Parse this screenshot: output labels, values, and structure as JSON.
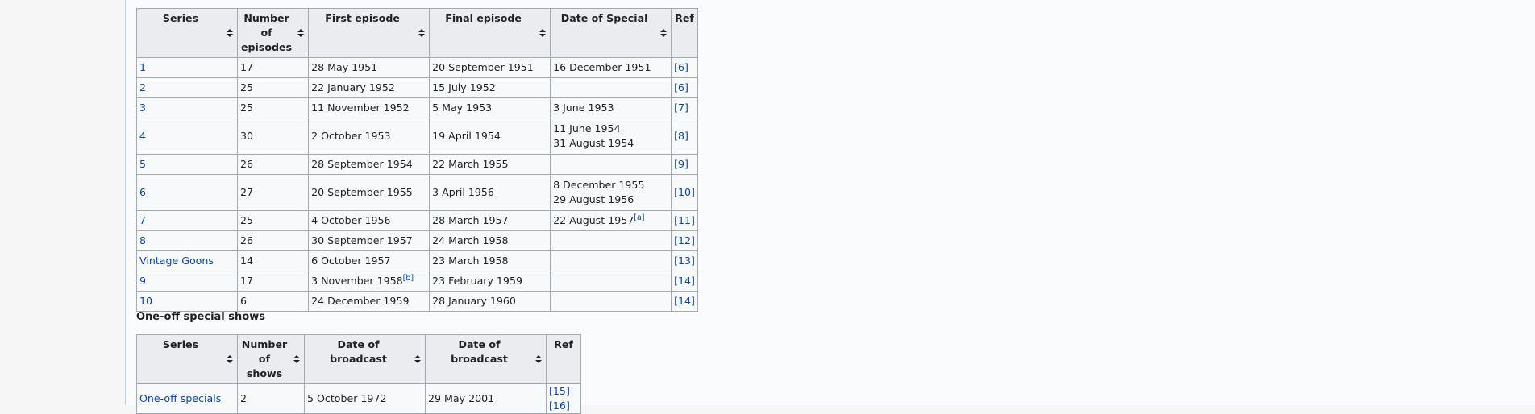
{
  "series_table": {
    "headers": [
      "Series",
      "Number of episodes",
      "First episode",
      "Final episode",
      "Date of Special",
      "Ref"
    ],
    "rows": [
      {
        "series": "1",
        "episodes": "17",
        "first": "28 May 1951",
        "final": "20 September 1951",
        "special": "16 December 1951",
        "special2": "",
        "special_note": "",
        "first_note": "",
        "ref": "[6]"
      },
      {
        "series": "2",
        "episodes": "25",
        "first": "22 January 1952",
        "final": "15 July 1952",
        "special": "",
        "special2": "",
        "special_note": "",
        "first_note": "",
        "ref": "[6]"
      },
      {
        "series": "3",
        "episodes": "25",
        "first": "11 November 1952",
        "final": "5 May 1953",
        "special": "3 June 1953",
        "special2": "",
        "special_note": "",
        "first_note": "",
        "ref": "[7]"
      },
      {
        "series": "4",
        "episodes": "30",
        "first": "2 October 1953",
        "final": "19 April 1954",
        "special": "11 June 1954",
        "special2": "31 August 1954",
        "special_note": "",
        "first_note": "",
        "ref": "[8]"
      },
      {
        "series": "5",
        "episodes": "26",
        "first": "28 September 1954",
        "final": "22 March 1955",
        "special": "",
        "special2": "",
        "special_note": "",
        "first_note": "",
        "ref": "[9]"
      },
      {
        "series": "6",
        "episodes": "27",
        "first": "20 September 1955",
        "final": "3 April 1956",
        "special": "8 December 1955",
        "special2": "29 August 1956",
        "special_note": "",
        "first_note": "",
        "ref": "[10]"
      },
      {
        "series": "7",
        "episodes": "25",
        "first": "4 October 1956",
        "final": "28 March 1957",
        "special": "22 August 1957",
        "special2": "",
        "special_note": "[a]",
        "first_note": "",
        "ref": "[11]"
      },
      {
        "series": "8",
        "episodes": "26",
        "first": "30 September 1957",
        "final": "24 March 1958",
        "special": "",
        "special2": "",
        "special_note": "",
        "first_note": "",
        "ref": "[12]"
      },
      {
        "series": "Vintage Goons",
        "episodes": "14",
        "first": "6 October 1957",
        "final": "23 March 1958",
        "special": "",
        "special2": "",
        "special_note": "",
        "first_note": "",
        "ref": "[13]"
      },
      {
        "series": "9",
        "episodes": "17",
        "first": "3 November 1958",
        "final": "23 February 1959",
        "special": "",
        "special2": "",
        "special_note": "",
        "first_note": "[b]",
        "ref": "[14]"
      },
      {
        "series": "10",
        "episodes": "6",
        "first": "24 December 1959",
        "final": "28 January 1960",
        "special": "",
        "special2": "",
        "special_note": "",
        "first_note": "",
        "ref": "[14]"
      }
    ]
  },
  "section_label": "One-off special shows",
  "oneoff_table": {
    "headers": [
      "Series",
      "Number of shows",
      "Date of broadcast",
      "Date of broadcast",
      "Ref"
    ],
    "rows": [
      {
        "series": "One-off specials",
        "shows": "2",
        "date1": "5 October 1972",
        "date2": "29 May 2001",
        "ref1": "[15]",
        "ref2": "[16]"
      }
    ]
  },
  "colors": {
    "link": "#0645ad",
    "header_bg": "#eaecf0",
    "border": "#a2a9b1"
  }
}
